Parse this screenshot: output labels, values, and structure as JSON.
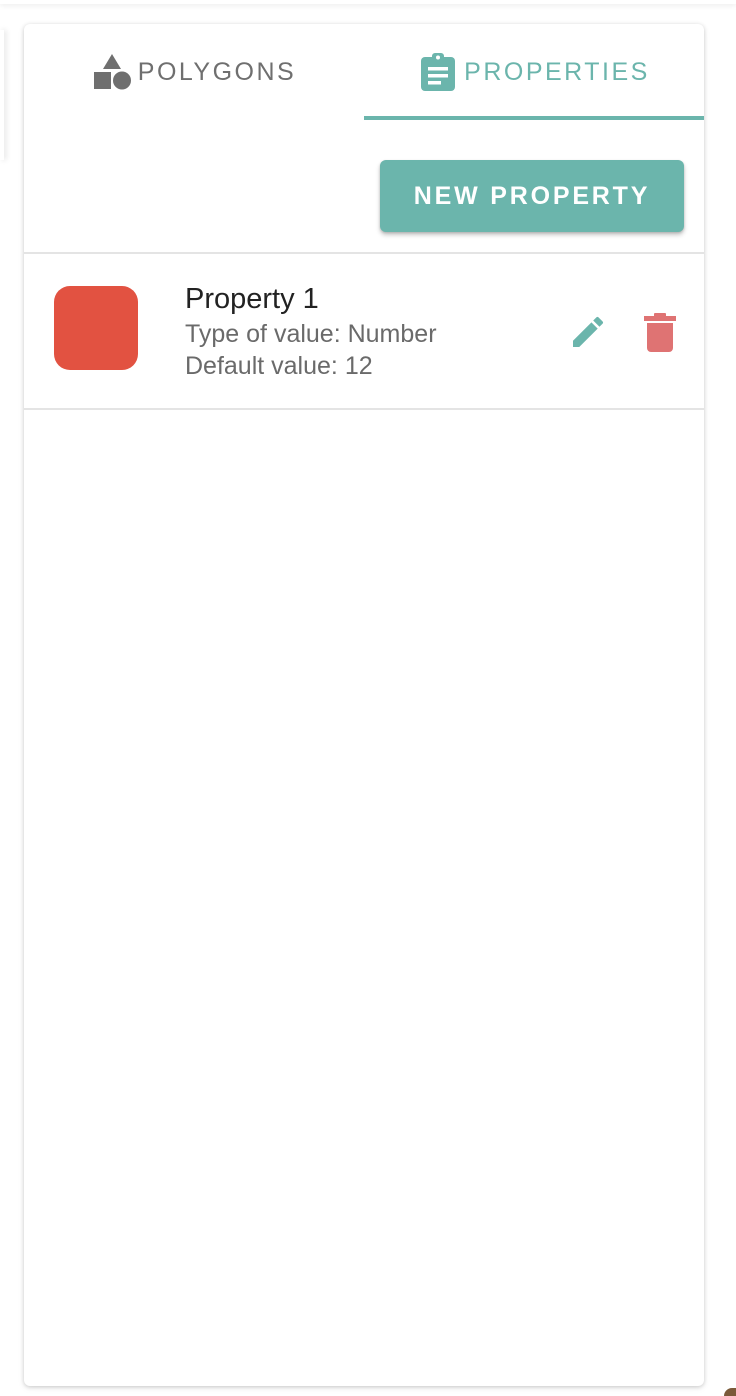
{
  "tabs": {
    "polygons": {
      "label": "POLYGONS",
      "icon": "shapes-icon"
    },
    "properties": {
      "label": "PROPERTIES",
      "icon": "clipboard-list-icon",
      "active": true
    }
  },
  "actions": {
    "new_property_label": "NEW PROPERTY"
  },
  "properties": [
    {
      "title": "Property 1",
      "type_line": "Type of value: Number",
      "default_line": "Default value: 12",
      "color": "#e25241"
    }
  ],
  "colors": {
    "accent": "#6bb5ac",
    "inactive_tab": "#6f6f6f",
    "delete": "#df7373"
  }
}
